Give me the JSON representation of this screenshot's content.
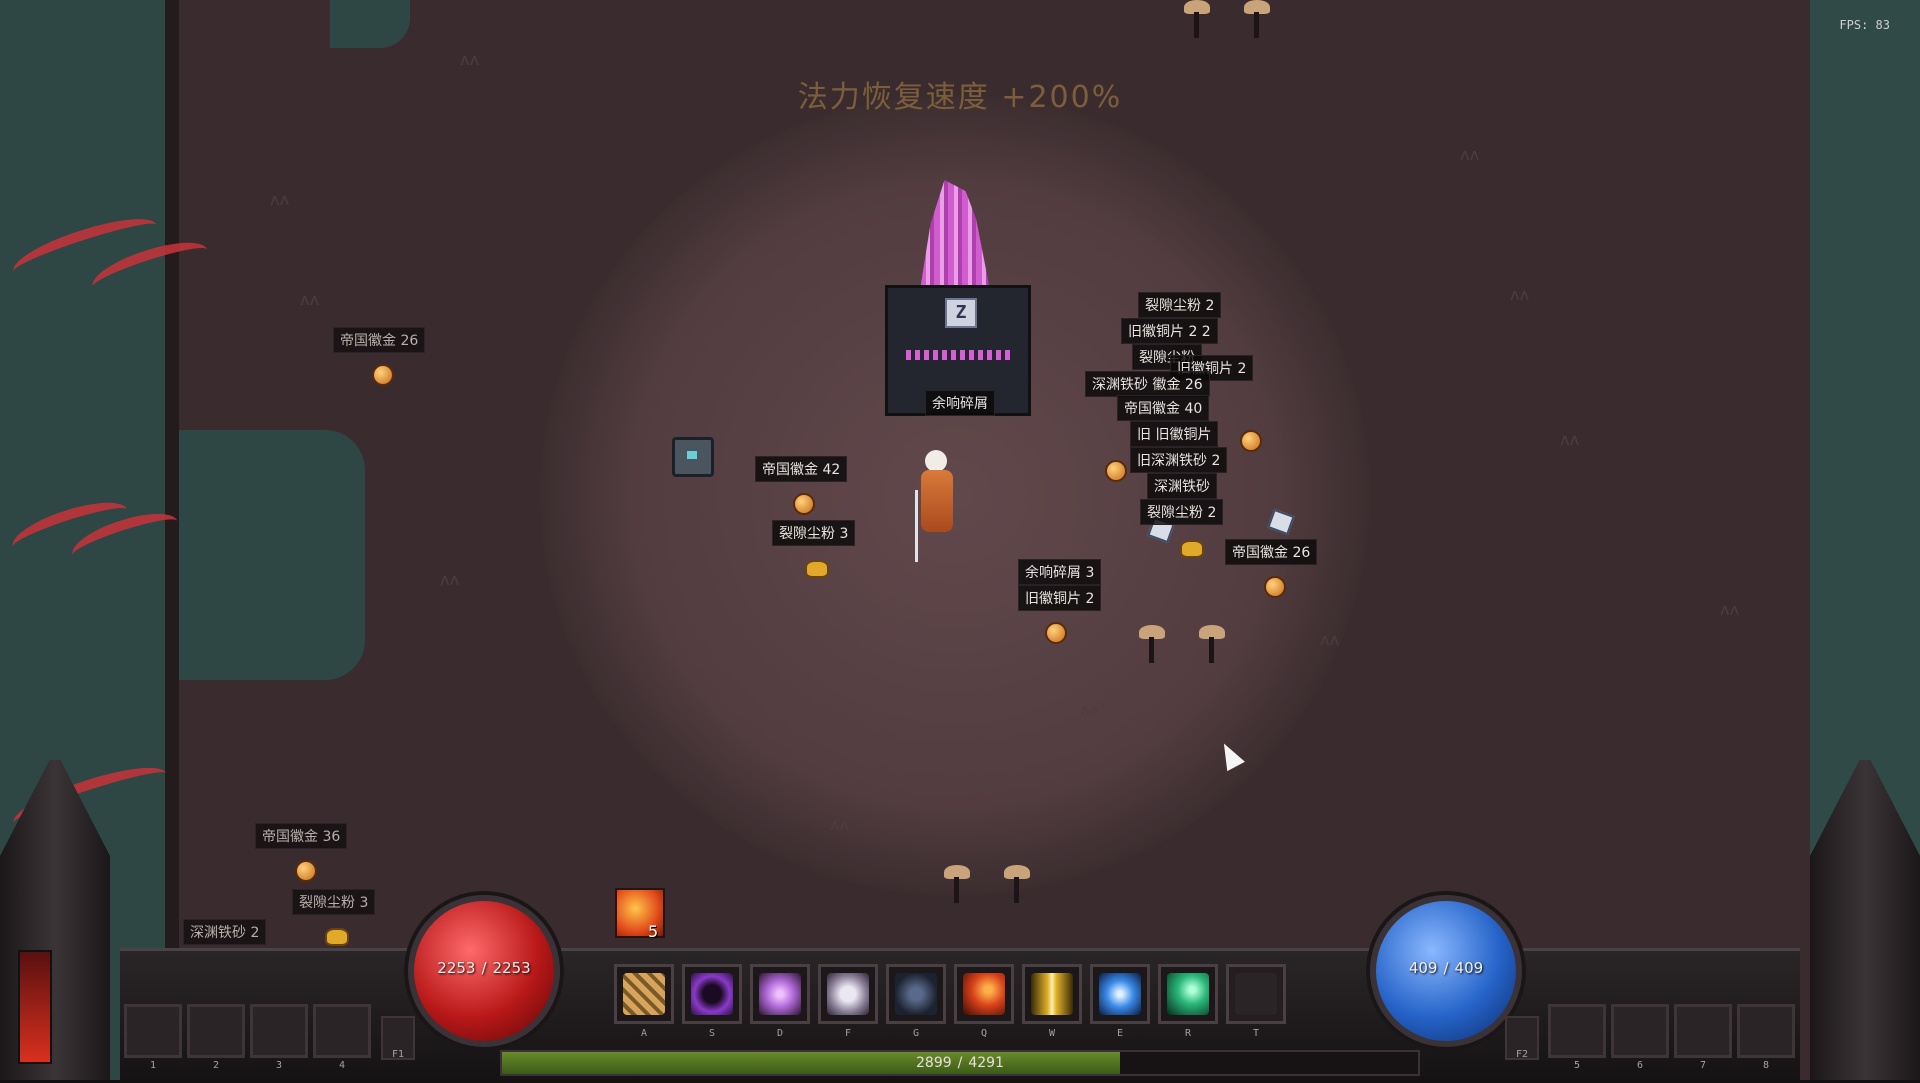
{
  "buff_notice": "法力恢复速度 +200%",
  "fps_label": "FPS: 83",
  "altar": {
    "key_hint": "Z"
  },
  "drops": [
    {
      "text": "帝国徽金 26",
      "kind": "coin"
    },
    {
      "text": "帝国徽金 42",
      "kind": "coin"
    },
    {
      "text": "裂隙尘粉 3",
      "kind": "dust"
    },
    {
      "text": "余响碎屑",
      "kind": "shard"
    },
    {
      "text": "裂隙尘粉 2",
      "kind": "dust"
    },
    {
      "text": "旧徽铜片 2 2",
      "kind": "copper"
    },
    {
      "text": "裂隙尘粉",
      "kind": "dust"
    },
    {
      "text": "旧徽铜片 2",
      "kind": "copper"
    },
    {
      "text": "深渊铁砂 徽金 26",
      "kind": "ore"
    },
    {
      "text": "帝国徽金 40",
      "kind": "coin"
    },
    {
      "text": "旧 旧徽铜片",
      "kind": "copper"
    },
    {
      "text": "旧深渊铁砂 2",
      "kind": "ore"
    },
    {
      "text": "深渊铁砂",
      "kind": "ore"
    },
    {
      "text": "裂隙尘粉 2",
      "kind": "dust"
    },
    {
      "text": "帝国徽金 26",
      "kind": "coin"
    },
    {
      "text": "余响碎屑 3",
      "kind": "shard"
    },
    {
      "text": "旧徽铜片 2",
      "kind": "copper"
    },
    {
      "text": "帝国徽金 36",
      "kind": "coin"
    },
    {
      "text": "裂隙尘粉 3",
      "kind": "dust"
    },
    {
      "text": "深渊铁砂 2",
      "kind": "ore"
    }
  ],
  "hud": {
    "hp": {
      "current": "2253",
      "separator": "/",
      "max": "2253",
      "fill": 1.0
    },
    "mp": {
      "current": "409",
      "separator": "/",
      "max": "409",
      "fill": 1.0
    },
    "buff_stack": "5",
    "skills": [
      {
        "key": "A",
        "icon": "striped-blade-icon",
        "color": "#d8a45a"
      },
      {
        "key": "S",
        "icon": "void-orb-icon",
        "color": "#8a3ac8"
      },
      {
        "key": "D",
        "icon": "arcane-burst-icon",
        "color": "#b06ad8"
      },
      {
        "key": "F",
        "icon": "angel-wings-icon",
        "color": "#c9c0d8"
      },
      {
        "key": "G",
        "icon": "shadow-figure-icon",
        "color": "#5a6a8a"
      },
      {
        "key": "Q",
        "icon": "meteor-icon",
        "color": "#d8421a"
      },
      {
        "key": "W",
        "icon": "light-pillar-icon",
        "color": "#e0b02a"
      },
      {
        "key": "E",
        "icon": "frost-nova-icon",
        "color": "#3a8ae8"
      },
      {
        "key": "R",
        "icon": "green-comet-icon",
        "color": "#2ab87a"
      },
      {
        "key": "T",
        "icon": "empty-slot-icon",
        "color": "#3a3234"
      }
    ],
    "potion_slots_left": [
      "1",
      "2",
      "3",
      "4"
    ],
    "potion_slots_right": [
      "5",
      "6",
      "7",
      "8"
    ],
    "fkey_left": "F1",
    "fkey_right": "F2",
    "xp": {
      "current": "2899",
      "separator": "/",
      "max": "4291",
      "fill": 0.675
    }
  },
  "colors": {
    "hp_orb": "#c81e1e",
    "mp_orb": "#2563c8",
    "xp_fill": "#5a7a22",
    "label_bg": "#0a0809"
  }
}
